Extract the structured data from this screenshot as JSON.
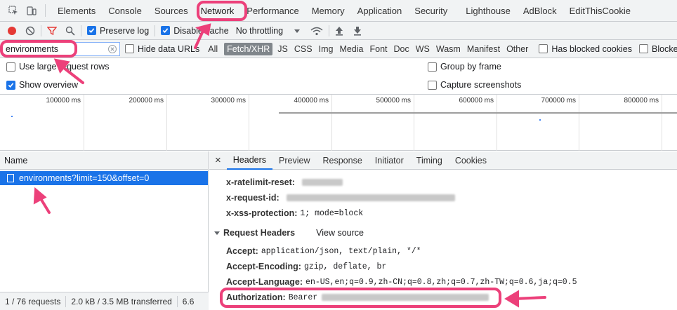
{
  "tabs": [
    "Elements",
    "Console",
    "Sources",
    "Network",
    "Performance",
    "Memory",
    "Application",
    "Security",
    "Lighthouse",
    "AdBlock",
    "EditThisCookie"
  ],
  "toolbar": {
    "preserve_log": "Preserve log",
    "disable_cache": "Disable cache",
    "throttling": "No throttling"
  },
  "filter": {
    "value": "environments",
    "hide_data_urls": "Hide data URLs",
    "types": [
      "All",
      "Fetch/XHR",
      "JS",
      "CSS",
      "Img",
      "Media",
      "Font",
      "Doc",
      "WS",
      "Wasm",
      "Manifest",
      "Other"
    ],
    "has_blocked_cookies": "Has blocked cookies",
    "blocked": "Blocked"
  },
  "options": {
    "large_rows": "Use large request rows",
    "show_overview": "Show overview",
    "group_by_frame": "Group by frame",
    "capture_screenshots": "Capture screenshots"
  },
  "overview": {
    "ticks": [
      "100000 ms",
      "200000 ms",
      "300000 ms",
      "400000 ms",
      "500000 ms",
      "600000 ms",
      "700000 ms",
      "800000 ms"
    ]
  },
  "requests": {
    "column": "Name",
    "rows": [
      "environments?limit=150&offset=0"
    ]
  },
  "status": {
    "count": "1 / 76 requests",
    "transferred": "2.0 kB / 3.5 MB transferred",
    "extra": "6.6"
  },
  "detail": {
    "close": "×",
    "tabs": [
      "Headers",
      "Preview",
      "Response",
      "Initiator",
      "Timing",
      "Cookies"
    ],
    "response_headers": [
      {
        "key": "x-ratelimit-reset:",
        "value": ""
      },
      {
        "key": "x-request-id:",
        "value": ""
      },
      {
        "key": "x-xss-protection:",
        "value": "1; mode=block"
      }
    ],
    "request_section": "Request Headers",
    "view_source": "View source",
    "request_headers": [
      {
        "key": "Accept:",
        "value": "application/json, text/plain, */*"
      },
      {
        "key": "Accept-Encoding:",
        "value": "gzip, deflate, br"
      },
      {
        "key": "Accept-Language:",
        "value": "en-US,en;q=0.9,zh-CN;q=0.8,zh;q=0.7,zh-TW;q=0.6,ja;q=0.5"
      },
      {
        "key": "Authorization:",
        "value": "Bearer"
      }
    ]
  },
  "colors": {
    "highlight": "#ec407a",
    "accent": "#1a73e8",
    "record": "#e53935"
  }
}
